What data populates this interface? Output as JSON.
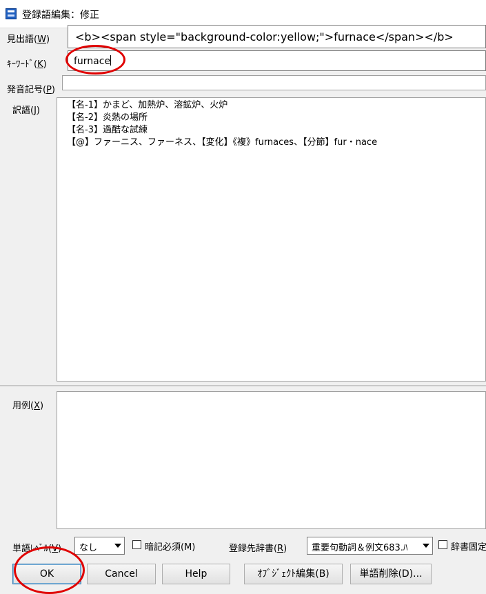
{
  "window": {
    "title": "登録語編集：修正"
  },
  "fields": {
    "headword_label_pre": "見出語(",
    "headword_label_key": "W",
    "headword_label_post": ")",
    "headword_value": "<b><span style=\"background-color:yellow;\">furnace</span></b>",
    "keyword_label_pre": "ｷｰﾜｰﾄﾞ(",
    "keyword_label_key": "K",
    "keyword_label_post": ")",
    "keyword_value": "furnace",
    "pron_label_pre": "発音記号(",
    "pron_label_key": "P",
    "pron_label_post": ")",
    "trans_label_pre": "訳語(",
    "trans_label_key": "J",
    "trans_label_post": ")",
    "translation_lines": [
      "【名-1】かまど、加熱炉、溶鉱炉、火炉",
      "【名-2】炎熱の場所",
      "【名-3】過酷な試練",
      "【@】ファーニス、ファーネス、【変化】《複》furnaces、【分節】fur・nace"
    ],
    "examples_label_pre": "用例(",
    "examples_label_key": "X",
    "examples_label_post": ")"
  },
  "options": {
    "level_label_pre": "単語ﾚﾍﾞﾙ(",
    "level_label_key": "V",
    "level_label_post": ")",
    "level_value": "なし",
    "memorize_label": "暗記必須(M)",
    "dict_label_pre": "登録先辞書(",
    "dict_label_key": "R",
    "dict_label_post": ")",
    "dict_value": "重要句動詞＆例文683.ﾊ",
    "fix_label": "辞書固定"
  },
  "buttons": {
    "ok": "OK",
    "cancel": "Cancel",
    "help": "Help",
    "object_edit": "ｵﾌﾞｼﾞｪｸﾄ編集(B)",
    "delete_word": "単語削除(D)..."
  },
  "colors": {
    "annotation_red": "#e00000",
    "selection_blue": "#3c7fb1"
  }
}
